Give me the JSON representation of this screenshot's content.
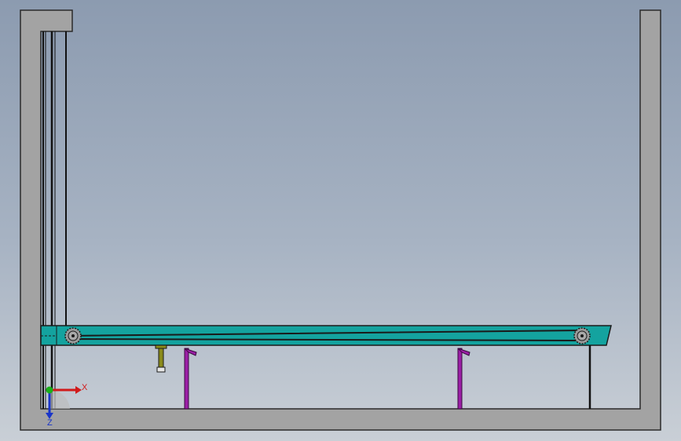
{
  "viewport": {
    "background_top": "#8c9bb0",
    "background_bottom": "#c9cfd6"
  },
  "scene": {
    "container_color": "#a3a3a3",
    "conveyor_color": "#14a39f",
    "support_color": "#9b1fa6",
    "bracket_color": "#8a8a1a",
    "sprocket_color": "#9a9a9a"
  },
  "triad": {
    "x_label": "X",
    "z_label": "Z",
    "x_color": "#d11a1a",
    "y_color": "#19b019",
    "z_color": "#1a35c9"
  }
}
